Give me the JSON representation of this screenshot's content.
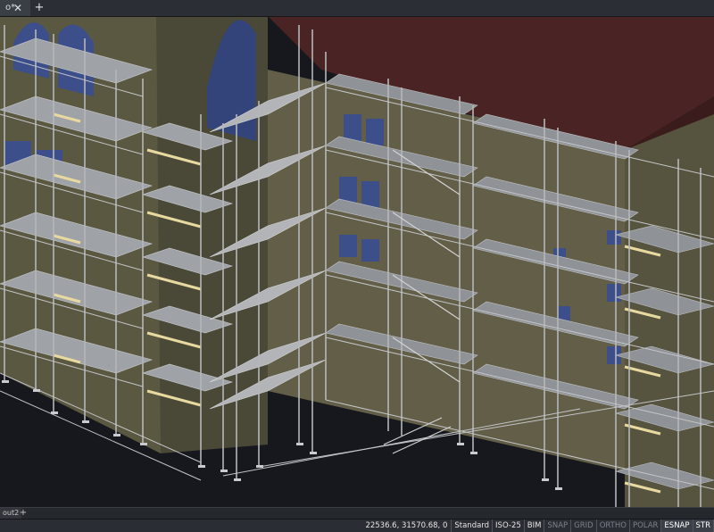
{
  "tabs": {
    "document_label": "o*",
    "close_glyph": "✕",
    "add_glyph": "+"
  },
  "layout_tabs": {
    "current": "out2",
    "add_glyph": "+"
  },
  "status_bar": {
    "coordinates": "22536.6, 31570.68, 0",
    "text_style": "Standard",
    "dim_style": "ISO-25",
    "bim": "BIM",
    "snap": "SNAP",
    "grid": "GRID",
    "ortho": "ORTHO",
    "polar": "POLAR",
    "esnap": "ESNAP",
    "str": "STR"
  },
  "colors": {
    "roof": "#4a2424",
    "wall": "#5e5a43",
    "ground": "#16181d",
    "scaffold": "#a8a8a8",
    "window_glass": "#3c4f8a",
    "plank_edge": "#e8d9a0"
  }
}
